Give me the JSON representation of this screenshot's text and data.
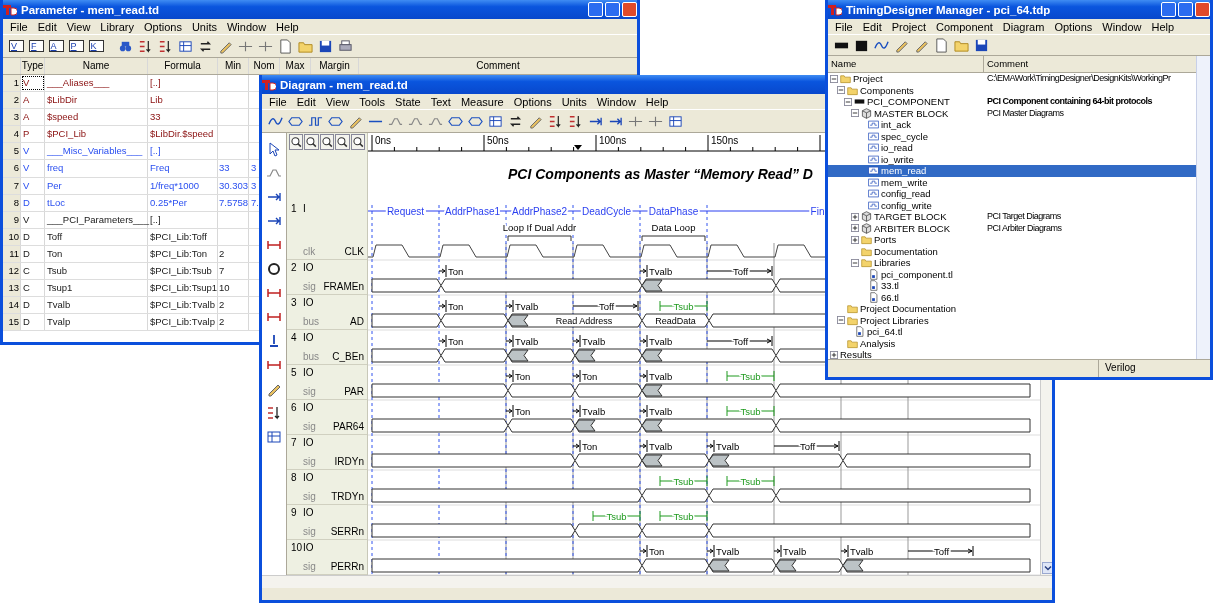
{
  "parameter_window": {
    "title": "Parameter - mem_read.td",
    "menu": [
      "File",
      "Edit",
      "View",
      "Library",
      "Options",
      "Units",
      "Window",
      "Help"
    ],
    "filter_buttons": [
      "V",
      "F",
      "A",
      "P",
      "K"
    ],
    "columns": [
      "Type",
      "Name",
      "Formula",
      "Min",
      "Nom",
      "Max",
      "Margin",
      "Comment"
    ],
    "rows": [
      {
        "num": "1",
        "type": "V",
        "name": "___Aliases___",
        "formula": "[..]",
        "kind": "alias",
        "selected": true
      },
      {
        "num": "2",
        "type": "A",
        "name": "$LibDir",
        "formula": "Lib",
        "kind": "alias",
        "selected": false
      },
      {
        "num": "3",
        "type": "A",
        "name": "$speed",
        "formula": "33",
        "kind": "alias",
        "selected": false
      },
      {
        "num": "4",
        "type": "P",
        "name": "$PCI_Lib",
        "formula": "$LibDir.$speed",
        "kind": "alias",
        "selected": false
      },
      {
        "num": "5",
        "type": "V",
        "name": "___Misc_Variables___",
        "formula": "[..]",
        "kind": "variable",
        "selected": false
      },
      {
        "num": "6",
        "type": "V",
        "name": "freq",
        "formula": "Freq",
        "min": "33",
        "nom": "3",
        "kind": "variable",
        "selected": false
      },
      {
        "num": "7",
        "type": "V",
        "name": "Per",
        "formula": "1/freq*1000",
        "min": "30.303",
        "nom": "3",
        "kind": "variable",
        "selected": false
      },
      {
        "num": "8",
        "type": "D",
        "name": "tLoc",
        "formula": "0.25*Per",
        "min": "7.5758",
        "nom": "7.",
        "kind": "variable",
        "selected": false
      },
      {
        "num": "9",
        "type": "V",
        "name": "___PCI_Parameters___",
        "formula": "[..]",
        "kind": "parameter",
        "selected": false
      },
      {
        "num": "10",
        "type": "D",
        "name": "Toff",
        "formula": "$PCI_Lib:Toff",
        "kind": "parameter",
        "selected": false
      },
      {
        "num": "11",
        "type": "D",
        "name": "Ton",
        "formula": "$PCI_Lib:Ton",
        "min": "2",
        "kind": "parameter",
        "selected": false
      },
      {
        "num": "12",
        "type": "C",
        "name": "Tsub",
        "formula": "$PCI_Lib:Tsub",
        "min": "7",
        "kind": "parameter",
        "selected": false
      },
      {
        "num": "13",
        "type": "C",
        "name": "Tsup1",
        "formula": "$PCI_Lib:Tsup1",
        "min": "10",
        "kind": "parameter",
        "selected": false
      },
      {
        "num": "14",
        "type": "D",
        "name": "Tvalb",
        "formula": "$PCI_Lib:Tvalb",
        "min": "2",
        "kind": "parameter",
        "selected": false
      },
      {
        "num": "15",
        "type": "D",
        "name": "Tvalp",
        "formula": "$PCI_Lib:Tvalp",
        "min": "2",
        "kind": "parameter",
        "selected": false
      }
    ]
  },
  "diagram_window": {
    "title": "Diagram - mem_read.td",
    "menu": [
      "File",
      "Edit",
      "View",
      "Tools",
      "State",
      "Text",
      "Measure",
      "Options",
      "Units",
      "Window",
      "Help"
    ],
    "ruler": [
      "0ns",
      "50ns",
      "100ns",
      "150ns"
    ],
    "heading": "PCI Components as Master “Memory Read” D",
    "phases": [
      {
        "label": "Request"
      },
      {
        "label": "AddrPhase1"
      },
      {
        "label": "AddrPhase2",
        "loop": "Loop If Dual Addr"
      },
      {
        "label": "DeadCycle"
      },
      {
        "label": "DataPhase",
        "loop": "Data Loop"
      },
      {
        "label": "Fin"
      }
    ],
    "clock": {
      "number": "1",
      "direction": "I",
      "type": "clk",
      "name": "CLK"
    },
    "signals": [
      {
        "number": "2",
        "direction": "IO",
        "type": "sig",
        "name": "FRAMEn",
        "notes": [
          {
            "label": "Ton",
            "kind": "delay"
          },
          {
            "label": "Tvalb",
            "kind": "delay"
          },
          {
            "label": "Toff",
            "kind": "span"
          }
        ]
      },
      {
        "number": "3",
        "direction": "IO",
        "type": "bus",
        "name": "AD",
        "notes": [
          {
            "label": "Ton",
            "kind": "delay"
          },
          {
            "label": "Tvalb",
            "kind": "delay"
          },
          {
            "label": "Toff",
            "kind": "span"
          },
          {
            "label": "Tsub",
            "kind": "setup"
          }
        ],
        "values": [
          "Read Address",
          "ReadData"
        ]
      },
      {
        "number": "4",
        "direction": "IO",
        "type": "bus",
        "name": "C_BEn",
        "notes": [
          {
            "label": "Ton",
            "kind": "delay"
          },
          {
            "label": "Tvalb",
            "kind": "delay"
          },
          {
            "label": "Tvalb",
            "kind": "delay"
          },
          {
            "label": "Tvalb",
            "kind": "delay"
          },
          {
            "label": "Toff",
            "kind": "span"
          }
        ]
      },
      {
        "number": "5",
        "direction": "IO",
        "type": "sig",
        "name": "PAR",
        "notes": [
          {
            "label": "Ton",
            "kind": "delay"
          },
          {
            "label": "Ton",
            "kind": "delay"
          },
          {
            "label": "Tvalb",
            "kind": "delay"
          },
          {
            "label": "Tsub",
            "kind": "setup"
          }
        ]
      },
      {
        "number": "6",
        "direction": "IO",
        "type": "sig",
        "name": "PAR64",
        "notes": [
          {
            "label": "Ton",
            "kind": "delay"
          },
          {
            "label": "Tvalb",
            "kind": "delay"
          },
          {
            "label": "Tvalb",
            "kind": "delay"
          },
          {
            "label": "Tsub",
            "kind": "setup"
          }
        ]
      },
      {
        "number": "7",
        "direction": "IO",
        "type": "sig",
        "name": "IRDYn",
        "notes": [
          {
            "label": "Ton",
            "kind": "delay"
          },
          {
            "label": "Tvalb",
            "kind": "delay"
          },
          {
            "label": "Tvalb",
            "kind": "delay"
          },
          {
            "label": "Toff",
            "kind": "span"
          }
        ]
      },
      {
        "number": "8",
        "direction": "IO",
        "type": "sig",
        "name": "TRDYn",
        "notes": [
          {
            "label": "Tsub",
            "kind": "setup"
          },
          {
            "label": "Tsub",
            "kind": "setup"
          }
        ]
      },
      {
        "number": "9",
        "direction": "IO",
        "type": "sig",
        "name": "SERRn",
        "notes": [
          {
            "label": "Tsub",
            "kind": "setup"
          },
          {
            "label": "Tsub",
            "kind": "setup"
          }
        ]
      },
      {
        "number": "10",
        "direction": "IO",
        "type": "sig",
        "name": "PERRn",
        "notes": [
          {
            "label": "Ton",
            "kind": "delay"
          },
          {
            "label": "Tvalb",
            "kind": "delay"
          },
          {
            "label": "Tvalb",
            "kind": "delay"
          },
          {
            "label": "Tvalb",
            "kind": "delay"
          },
          {
            "label": "Toff",
            "kind": "span"
          }
        ]
      }
    ]
  },
  "manager_window": {
    "title": "TimingDesigner Manager - pci_64.tdp",
    "menu": [
      "File",
      "Edit",
      "Project",
      "Component",
      "Diagram",
      "Options",
      "Window",
      "Help"
    ],
    "columns": [
      "Name",
      "Comment"
    ],
    "tree": [
      {
        "label": "Project",
        "kind": "folder",
        "expanded": true,
        "selected": false,
        "comment": "C:\\EMAWork\\TimingDesigner\\DesignKits\\WorkingPr",
        "children": [
          {
            "label": "Components",
            "kind": "folder",
            "expanded": true,
            "selected": false,
            "children": [
              {
                "label": "PCI_COMPONENT",
                "kind": "component",
                "expanded": true,
                "selected": false,
                "comment": "PCI Component containing 64-bit protocols",
                "children": [
                  {
                    "label": "MASTER BLOCK",
                    "kind": "block",
                    "expanded": true,
                    "selected": false,
                    "comment": "PCI Master Diagrams",
                    "children": [
                      {
                        "label": "int_ack",
                        "kind": "diagram",
                        "selected": false
                      },
                      {
                        "label": "spec_cycle",
                        "kind": "diagram",
                        "selected": false
                      },
                      {
                        "label": "io_read",
                        "kind": "diagram",
                        "selected": false
                      },
                      {
                        "label": "io_write",
                        "kind": "diagram",
                        "selected": false
                      },
                      {
                        "label": "mem_read",
                        "kind": "diagram",
                        "selected": true
                      },
                      {
                        "label": "mem_write",
                        "kind": "diagram",
                        "selected": false
                      },
                      {
                        "label": "config_read",
                        "kind": "diagram",
                        "selected": false
                      },
                      {
                        "label": "config_write",
                        "kind": "diagram",
                        "selected": false
                      }
                    ]
                  },
                  {
                    "label": "TARGET BLOCK",
                    "kind": "block",
                    "expanded": false,
                    "selected": false,
                    "comment": "PCI Target Diagrams"
                  },
                  {
                    "label": "ARBITER BLOCK",
                    "kind": "block",
                    "expanded": false,
                    "selected": false,
                    "comment": "PCI Arbiter Diagrams"
                  },
                  {
                    "label": "Ports",
                    "kind": "folder",
                    "expanded": false,
                    "selected": false
                  },
                  {
                    "label": "Documentation",
                    "kind": "folder",
                    "selected": false
                  },
                  {
                    "label": "Libraries",
                    "kind": "folder",
                    "expanded": true,
                    "selected": false,
                    "children": [
                      {
                        "label": "pci_component.tl",
                        "kind": "file",
                        "selected": false
                      },
                      {
                        "label": "33.tl",
                        "kind": "file",
                        "selected": false
                      },
                      {
                        "label": "66.tl",
                        "kind": "file",
                        "selected": false
                      }
                    ]
                  }
                ]
              }
            ]
          },
          {
            "label": "Project Documentation",
            "kind": "folder",
            "selected": false
          },
          {
            "label": "Project Libraries",
            "kind": "folder",
            "expanded": true,
            "selected": false,
            "children": [
              {
                "label": "pci_64.tl",
                "kind": "file",
                "selected": false
              }
            ]
          },
          {
            "label": "Analysis",
            "kind": "folder",
            "selected": false
          }
        ]
      },
      {
        "label": "Results",
        "kind": "plain",
        "expanded": false,
        "selected": false
      }
    ],
    "status": "Verilog"
  }
}
